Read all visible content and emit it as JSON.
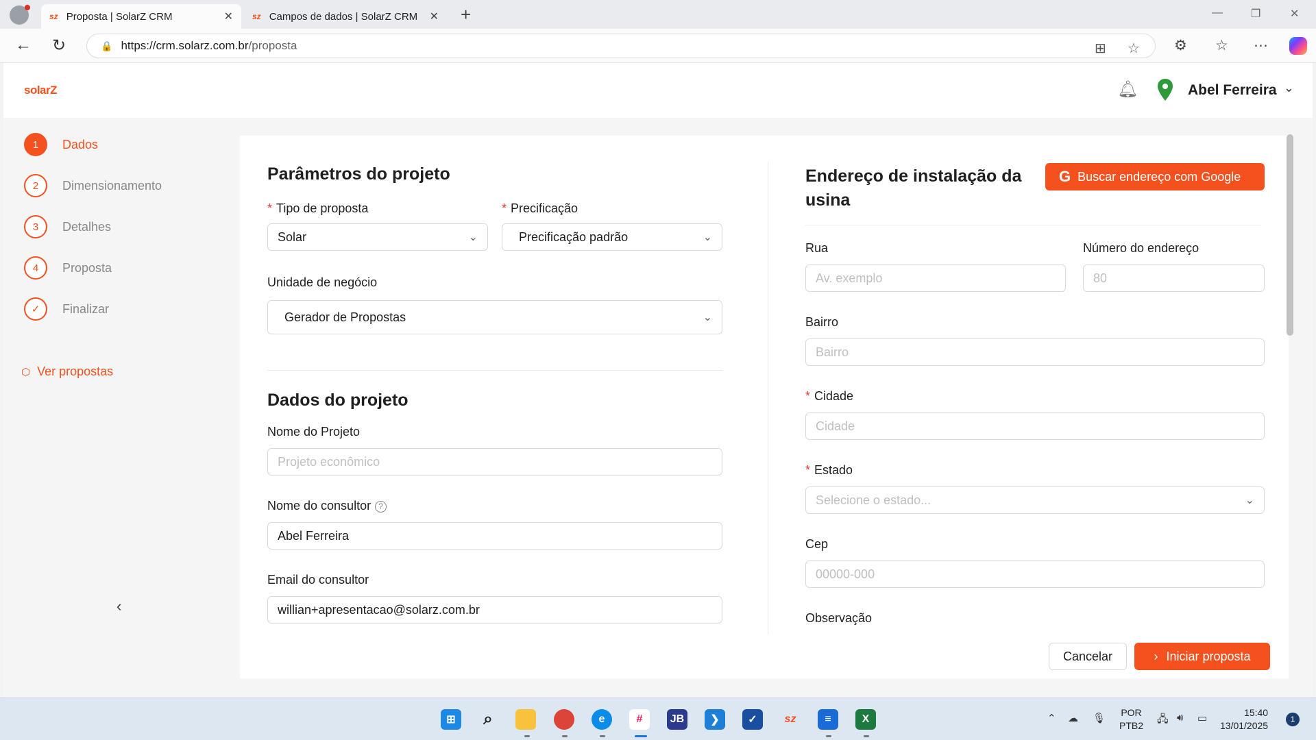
{
  "browser": {
    "tabs": [
      {
        "title": "Proposta | SolarZ CRM",
        "favicon": "sz"
      },
      {
        "title": "Campos de dados | SolarZ CRM",
        "favicon": "sz"
      }
    ],
    "url_host": "https://crm.solarz.com.br",
    "url_path": "/proposta"
  },
  "app": {
    "logo": "solarZ",
    "user_name": "Abel Ferreira",
    "accent": "#f4511e"
  },
  "steps": [
    {
      "num": "1",
      "label": "Dados"
    },
    {
      "num": "2",
      "label": "Dimensionamento"
    },
    {
      "num": "3",
      "label": "Detalhes"
    },
    {
      "num": "4",
      "label": "Proposta"
    },
    {
      "num": "✓",
      "label": "Finalizar"
    }
  ],
  "ver_propostas": "Ver propostas",
  "params": {
    "title": "Parâmetros do projeto",
    "tipo_label": "Tipo de proposta",
    "tipo_value": "Solar",
    "prec_label": "Precificação",
    "prec_value": "Precificação padrão",
    "unidade_label": "Unidade de negócio",
    "unidade_value": "Gerador de Propostas"
  },
  "dados": {
    "title": "Dados do projeto",
    "nome_label": "Nome do Projeto",
    "nome_placeholder": "Projeto econômico",
    "consultor_label": "Nome do consultor",
    "consultor_value": "Abel Ferreira",
    "email_label": "Email do consultor",
    "email_value": "willian+apresentacao@solarz.com.br"
  },
  "endereco": {
    "title_line1": "Endereço de instalação da",
    "title_line2": "usina",
    "google_button": "Buscar endereço com Google",
    "rua_label": "Rua",
    "rua_placeholder": "Av. exemplo",
    "numero_label": "Número do endereço",
    "numero_placeholder": "80",
    "bairro_label": "Bairro",
    "bairro_placeholder": "Bairro",
    "cidade_label": "Cidade",
    "cidade_placeholder": "Cidade",
    "estado_label": "Estado",
    "estado_placeholder": "Selecione o estado...",
    "cep_label": "Cep",
    "cep_placeholder": "00000-000",
    "obs_label": "Observação"
  },
  "actions": {
    "cancel": "Cancelar",
    "start": "Iniciar proposta"
  },
  "taskbar": {
    "lang_line1": "POR",
    "lang_line2": "PTB2",
    "time": "15:40",
    "date": "13/01/2025",
    "notifications": "1"
  }
}
